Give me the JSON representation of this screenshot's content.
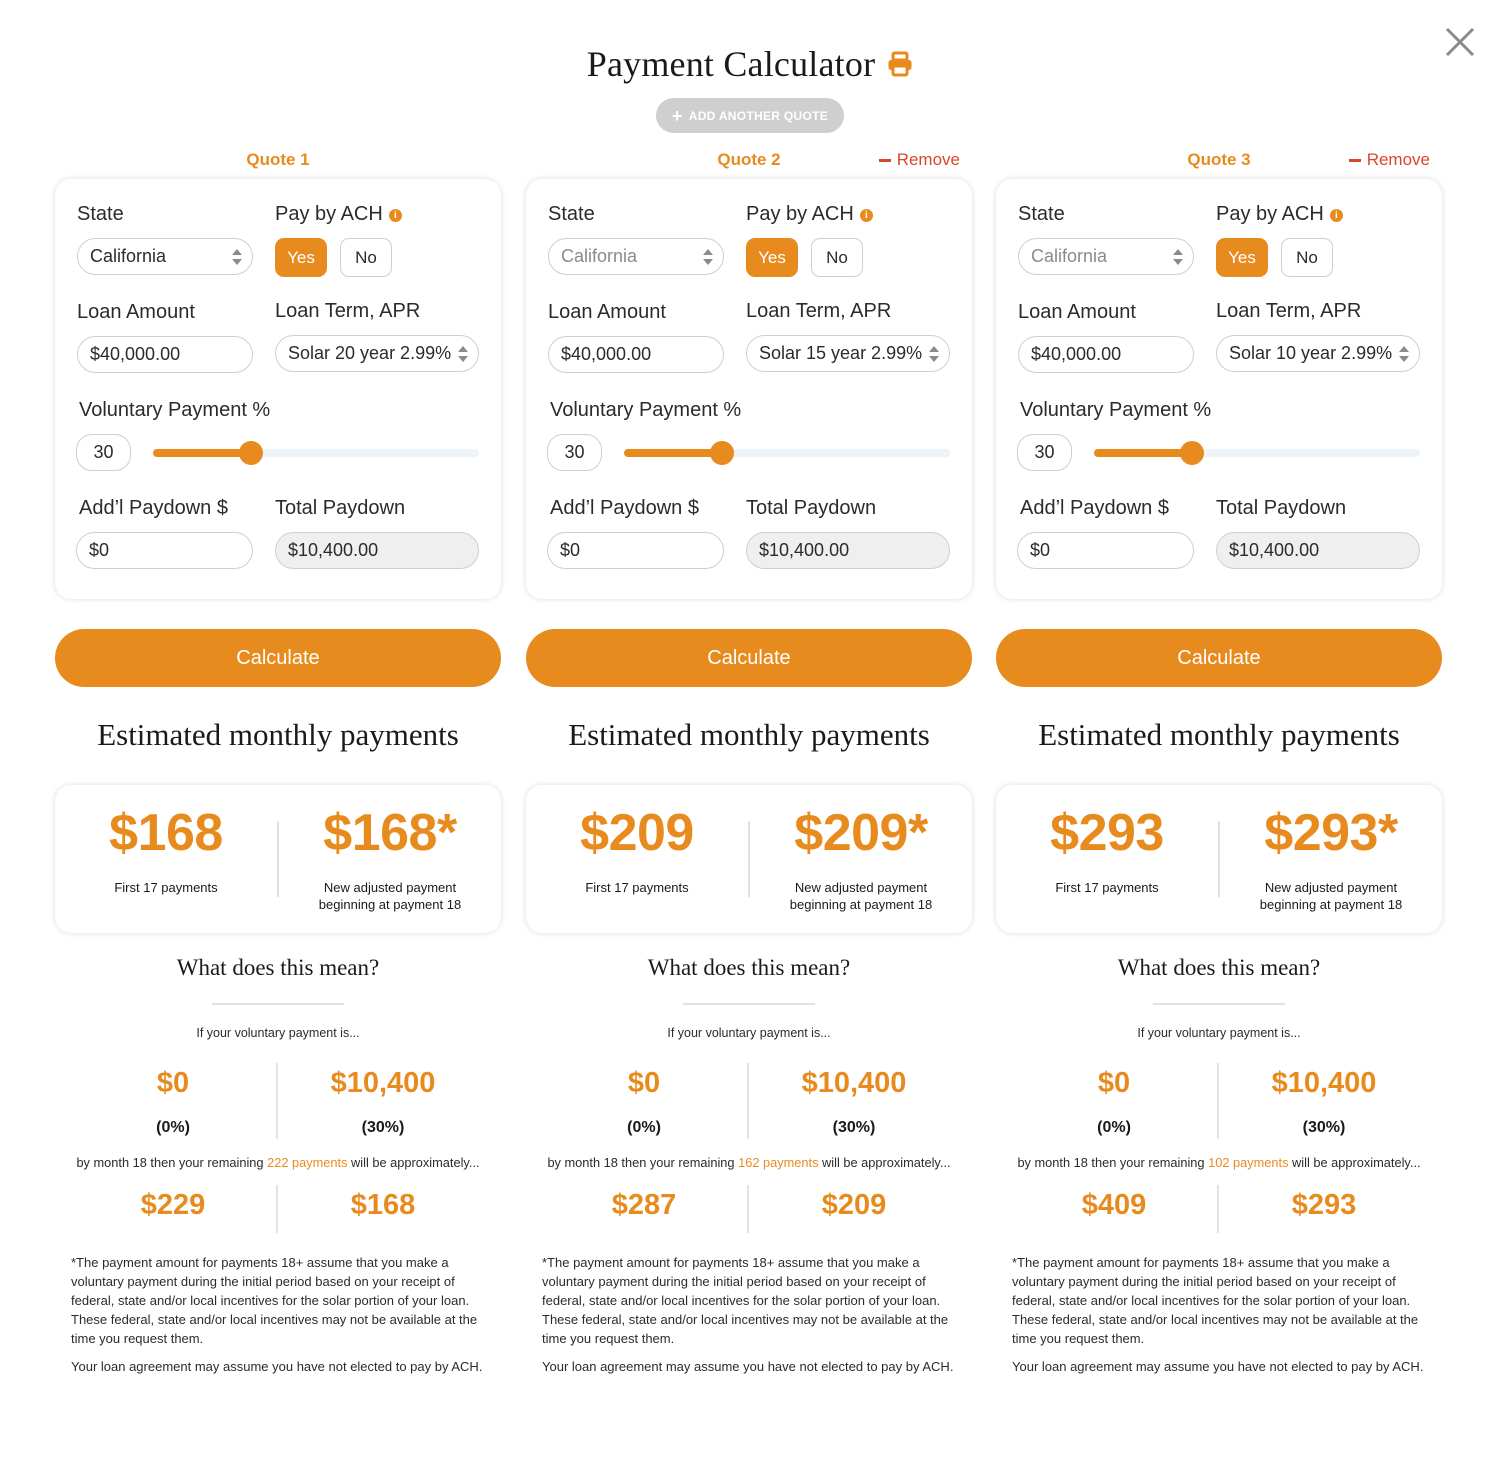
{
  "header": {
    "title": "Payment Calculator",
    "print_icon": "printer-icon",
    "add_quote_label": "ADD ANOTHER QUOTE",
    "close_icon": "close-icon"
  },
  "colors": {
    "accent": "#e88b1f",
    "remove": "#d9472b",
    "add_button_bg": "#cfcfcf"
  },
  "labels": {
    "state": "State",
    "pay_by_ach": "Pay by ACH",
    "yes": "Yes",
    "no": "No",
    "loan_amount": "Loan Amount",
    "loan_term": "Loan Term, APR",
    "voluntary_pct": "Voluntary Payment %",
    "addl_paydown": "Add’l Paydown $",
    "total_paydown": "Total Paydown",
    "calculate": "Calculate",
    "estimated": "Estimated monthly payments",
    "first_payments": "First 17 payments",
    "adjusted_line1": "New adjusted payment",
    "adjusted_line2": "beginning at payment 18",
    "what_mean": "What does this mean?",
    "if_voluntary": "If your voluntary payment is...",
    "month_prefix": "by month 18 then your remaining ",
    "month_payments_word": "payments",
    "month_suffix": " will be approximately...",
    "footnote": "*The payment amount for payments 18+ assume that you make a voluntary payment during the initial period based on your receipt of federal, state and/or local incentives for the solar portion of your loan. These federal, state and/or local incentives may not be available at the time you request them.",
    "ach_note": "Your loan agreement may assume you have not elected to pay by ACH.",
    "remove": "Remove"
  },
  "quotes": [
    {
      "title": "Quote 1",
      "removable": false,
      "state": "California",
      "ach_selected": "Yes",
      "loan_amount": "$40,000.00",
      "loan_term": "Solar 20 year 2.99%",
      "voluntary_pct": "30",
      "voluntary_fraction": 0.3,
      "addl_paydown": "$0",
      "total_paydown": "$10,400.00",
      "first_payment": "$168",
      "adjusted_payment": "$168*",
      "vol_low_amt": "$0",
      "vol_low_pct": "(0%)",
      "vol_high_amt": "$10,400",
      "vol_high_pct": "(30%)",
      "remaining_count": "222",
      "remaining_low": "$229",
      "remaining_high": "$168"
    },
    {
      "title": "Quote 2",
      "removable": true,
      "state": "California",
      "ach_selected": "Yes",
      "loan_amount": "$40,000.00",
      "loan_term": "Solar 15 year 2.99%",
      "voluntary_pct": "30",
      "voluntary_fraction": 0.3,
      "addl_paydown": "$0",
      "total_paydown": "$10,400.00",
      "first_payment": "$209",
      "adjusted_payment": "$209*",
      "vol_low_amt": "$0",
      "vol_low_pct": "(0%)",
      "vol_high_amt": "$10,400",
      "vol_high_pct": "(30%)",
      "remaining_count": "162",
      "remaining_low": "$287",
      "remaining_high": "$209"
    },
    {
      "title": "Quote 3",
      "removable": true,
      "state": "California",
      "ach_selected": "Yes",
      "loan_amount": "$40,000.00",
      "loan_term": "Solar 10 year 2.99%",
      "voluntary_pct": "30",
      "voluntary_fraction": 0.3,
      "addl_paydown": "$0",
      "total_paydown": "$10,400.00",
      "first_payment": "$293",
      "adjusted_payment": "$293*",
      "vol_low_amt": "$0",
      "vol_low_pct": "(0%)",
      "vol_high_amt": "$10,400",
      "vol_high_pct": "(30%)",
      "remaining_count": "102",
      "remaining_low": "$409",
      "remaining_high": "$293"
    }
  ]
}
